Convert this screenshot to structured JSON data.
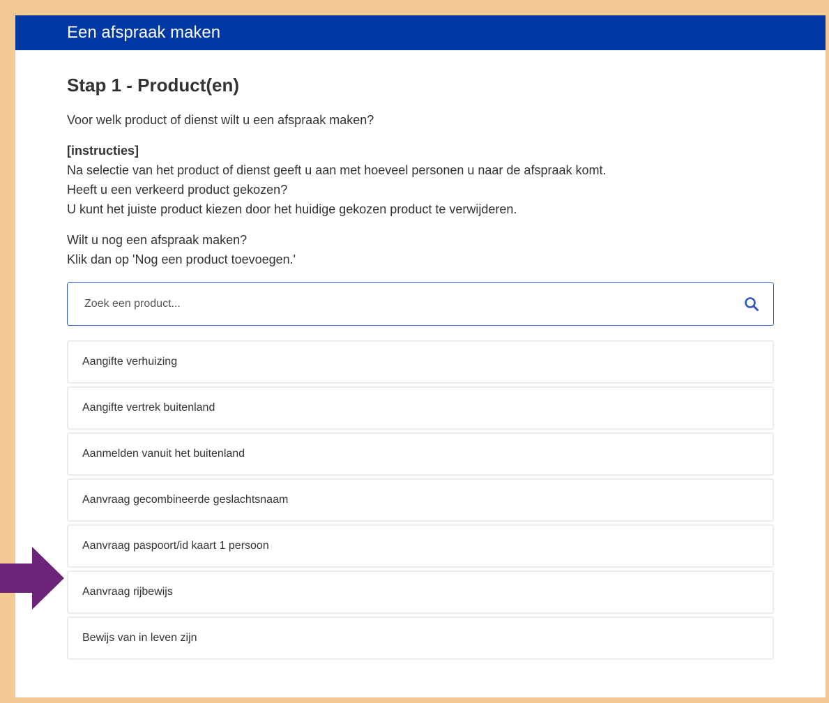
{
  "header": {
    "title": "Een afspraak maken"
  },
  "page": {
    "title": "Stap 1 - Product(en)"
  },
  "intro": "Voor welk product of dienst wilt u een afspraak maken?",
  "instructions": {
    "heading": "[instructies]",
    "lines": [
      "Na selectie van het product of dienst geeft u aan met hoeveel personen u naar de afspraak komt.",
      "Heeft u een verkeerd product gekozen?",
      "U kunt het juiste product kiezen door het huidige gekozen product te verwijderen."
    ]
  },
  "more": {
    "lines": [
      "Wilt u nog een afspraak maken?",
      "Klik dan op 'Nog een product toevoegen.'"
    ]
  },
  "search": {
    "placeholder": "Zoek een product...",
    "value": "",
    "icon": "search-icon"
  },
  "products": [
    "Aangifte verhuizing",
    "Aangifte vertrek buitenland",
    "Aanmelden vanuit het buitenland",
    "Aanvraag gecombineerde geslachtsnaam",
    "Aanvraag paspoort/id kaart 1 persoon",
    "Aanvraag rijbewijs",
    "Bewijs van in leven zijn"
  ],
  "colors": {
    "accent": "#0039a6",
    "background": "#f2c992",
    "arrow": "#6b2477",
    "search_border": "#2f58c2"
  }
}
